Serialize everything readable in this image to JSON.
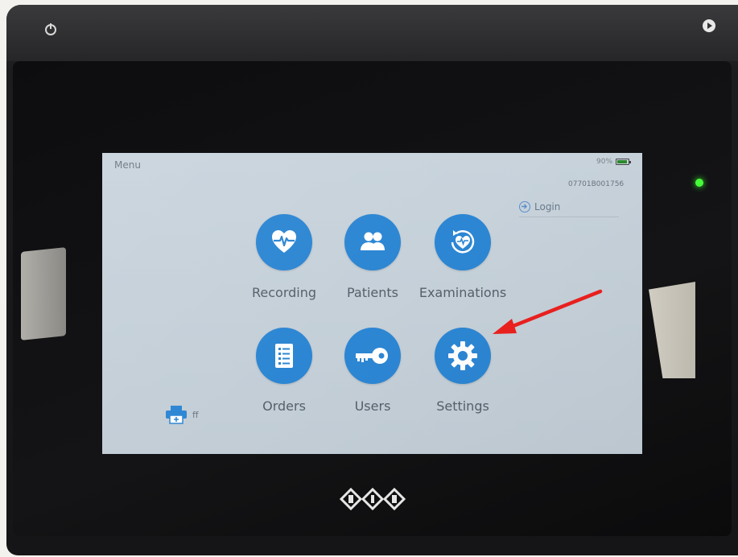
{
  "status_bar": {
    "title": "Menu",
    "battery_text": "90%",
    "device_id": "07701B001756"
  },
  "login": {
    "label": "Login"
  },
  "menu_items": [
    {
      "label": "Recording",
      "icon": "heart-pulse-icon"
    },
    {
      "label": "Patients",
      "icon": "people-icon"
    },
    {
      "label": "Examinations",
      "icon": "heart-refresh-icon"
    },
    {
      "label": "Orders",
      "icon": "list-document-icon"
    },
    {
      "label": "Users",
      "icon": "key-icon"
    },
    {
      "label": "Settings",
      "icon": "gear-icon"
    }
  ],
  "printer": {
    "label": "ff",
    "icon": "printer-icon"
  },
  "colors": {
    "icon_circle": "#2c86d3",
    "screen_bg": "#c5d0d9",
    "annotation_arrow": "#e8201e",
    "status_led": "#46ff3a"
  }
}
